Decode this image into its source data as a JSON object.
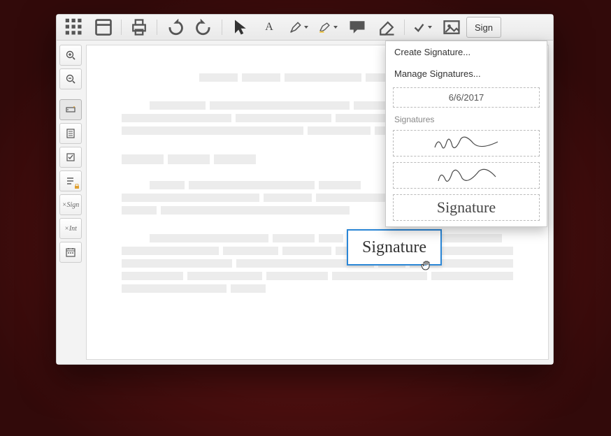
{
  "toolbar": {
    "sign_label": "Sign"
  },
  "dropdown": {
    "create": "Create Signature...",
    "manage": "Manage Signatures...",
    "date": "6/6/2017",
    "signatures_label": "Signatures",
    "sig3": "Signature"
  },
  "placing": {
    "label": "Signature"
  },
  "side": {
    "sign": "Sign",
    "init": "Int"
  }
}
